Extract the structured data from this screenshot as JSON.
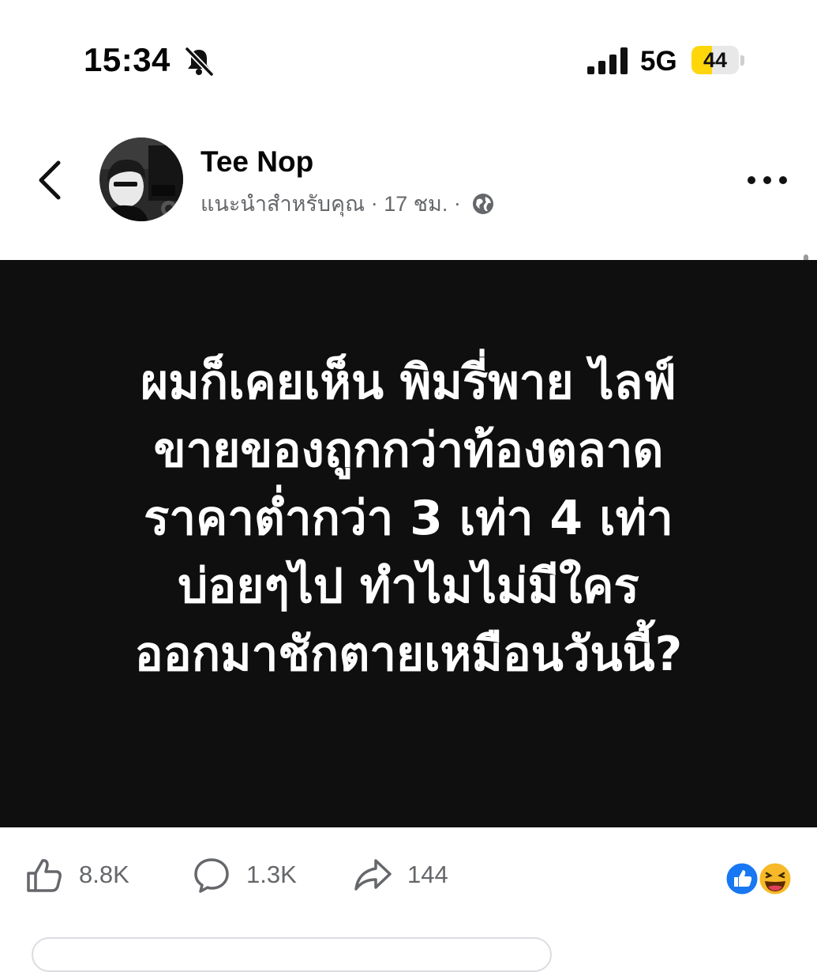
{
  "status_bar": {
    "time": "15:34",
    "bell_icon": "bell-slash-icon",
    "network": "5G",
    "battery_level": "44",
    "battery_fraction": 0.44,
    "battery_color": "#ffd60a"
  },
  "post": {
    "author": "Tee Nop",
    "subtitle": "แนะนำสำหรับคุณ",
    "separator": "·",
    "time_ago": "17 ชม.",
    "privacy_icon": "globe-icon",
    "image_text_lines": [
      "ผมก็เคยเห็น พิมรี่พาย ไลฟ์",
      "ขายของถูกกว่าท้องตลาด",
      "ราคาต่ำกว่า 3 เท่า 4 เท่า",
      "บ่อยๆไป ทำไมไม่มีใคร",
      "ออกมาชักตายเหมือนวันนี้?"
    ]
  },
  "actions": {
    "likes": "8.8K",
    "comments": "1.3K",
    "shares": "144"
  },
  "colors": {
    "background": "#ffffff",
    "image_background": "#0f0f0f",
    "secondary_text": "#65676b",
    "like_blue": "#1877f2",
    "haha_yellow": "#f7b928"
  }
}
